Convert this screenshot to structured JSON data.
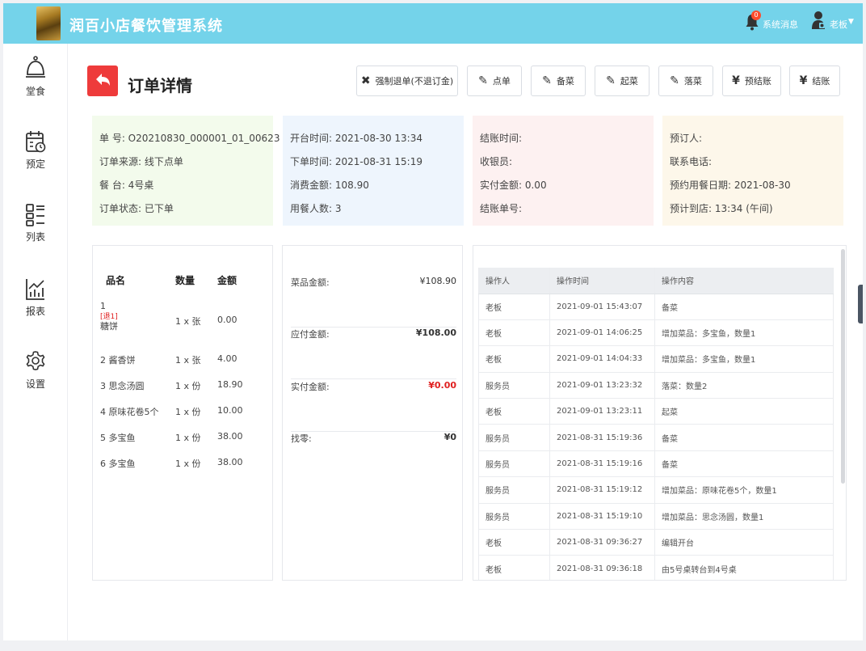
{
  "header": {
    "app_title": "润百小店餐饮管理系统",
    "badge_count": "0",
    "messages_label": "系统消息",
    "user_label": "老板"
  },
  "sidebar": {
    "items": [
      {
        "label": "堂食",
        "icon": "service-bell-icon"
      },
      {
        "label": "预定",
        "icon": "calendar-clock-icon"
      },
      {
        "label": "列表",
        "icon": "list-icon"
      },
      {
        "label": "报表",
        "icon": "chart-icon"
      },
      {
        "label": "设置",
        "icon": "gear-icon"
      }
    ]
  },
  "page": {
    "title": "订单详情",
    "actions": [
      {
        "icon": "✖",
        "label": "强制退单(不退订金)"
      },
      {
        "icon": "✎",
        "label": "点单"
      },
      {
        "icon": "✎",
        "label": "备菜"
      },
      {
        "icon": "✎",
        "label": "起菜"
      },
      {
        "icon": "✎",
        "label": "落菜"
      },
      {
        "icon": "¥",
        "label": "预结账"
      },
      {
        "icon": "¥",
        "label": "结账"
      }
    ]
  },
  "info": {
    "order": [
      "单 号:  O20210830_000001_01_00623",
      "订单来源:  线下点单",
      "餐 台:  4号桌",
      "订单状态:  已下单"
    ],
    "times": [
      "开台时间:  2021-08-30 13:34",
      "下单时间:  2021-08-31 15:19",
      "消费金额:  108.90",
      "用餐人数:  3"
    ],
    "checkout": [
      "结账时间:",
      "收银员:",
      "实付金额:  0.00",
      "结账单号:"
    ],
    "reservation": [
      "预订人:",
      "联系电话:",
      "预约用餐日期:  2021-08-30",
      "预计到店:  13:34 (午间)"
    ]
  },
  "items": {
    "headers": [
      "品名",
      "数量",
      "金额"
    ],
    "rows": [
      {
        "num": "1",
        "tag": "[退1]",
        "name": "糖饼",
        "qty": "1 x 张",
        "amount": "0.00"
      },
      {
        "num": "2",
        "tag": "",
        "name": "酱香饼",
        "qty": "1 x 张",
        "amount": "4.00"
      },
      {
        "num": "3",
        "tag": "",
        "name": "思念汤圆",
        "qty": "1 x 份",
        "amount": "18.90"
      },
      {
        "num": "4",
        "tag": "",
        "name": "原味花卷5个",
        "qty": "1 x 份",
        "amount": "10.00"
      },
      {
        "num": "5",
        "tag": "",
        "name": "多宝鱼",
        "qty": "1 x 份",
        "amount": "38.00"
      },
      {
        "num": "6",
        "tag": "",
        "name": "多宝鱼",
        "qty": "1 x 份",
        "amount": "38.00"
      }
    ]
  },
  "summary": [
    {
      "label": "菜品金额:",
      "value": "¥108.90",
      "color": "#333333"
    },
    {
      "label": "应付金额:",
      "value": "¥108.00",
      "color": "#222222"
    },
    {
      "label": "实付金额:",
      "value": "¥0.00",
      "color": "#e02020"
    },
    {
      "label": "找零:",
      "value": "¥0",
      "color": "#222222"
    }
  ],
  "log": {
    "headers": [
      "操作人",
      "操作时间",
      "操作内容"
    ],
    "rows": [
      [
        "老板",
        "2021-09-01 15:43:07",
        "备菜"
      ],
      [
        "老板",
        "2021-09-01 14:06:25",
        "增加菜品：多宝鱼，数量1"
      ],
      [
        "老板",
        "2021-09-01 14:04:33",
        "增加菜品：多宝鱼，数量1"
      ],
      [
        "服务员",
        "2021-09-01 13:23:32",
        "落菜：数量2"
      ],
      [
        "老板",
        "2021-09-01 13:23:11",
        "起菜"
      ],
      [
        "服务员",
        "2021-08-31 15:19:36",
        "备菜"
      ],
      [
        "服务员",
        "2021-08-31 15:19:16",
        "备菜"
      ],
      [
        "服务员",
        "2021-08-31 15:19:12",
        "增加菜品：原味花卷5个，数量1"
      ],
      [
        "服务员",
        "2021-08-31 15:19:10",
        "增加菜品：思念汤圆，数量1"
      ],
      [
        "老板",
        "2021-08-31 09:36:27",
        "编辑开台"
      ],
      [
        "老板",
        "2021-08-31 09:36:18",
        "由5号桌转台到4号桌"
      ]
    ]
  },
  "colors": {
    "header_bg": "#74d3ea",
    "back_button": "#ee3b3b",
    "card_order": "#f3fbec",
    "card_times": "#eef5fd",
    "card_checkout": "#fdf1f1",
    "card_reservation": "#fdf7ea",
    "accent_red": "#e02020"
  }
}
